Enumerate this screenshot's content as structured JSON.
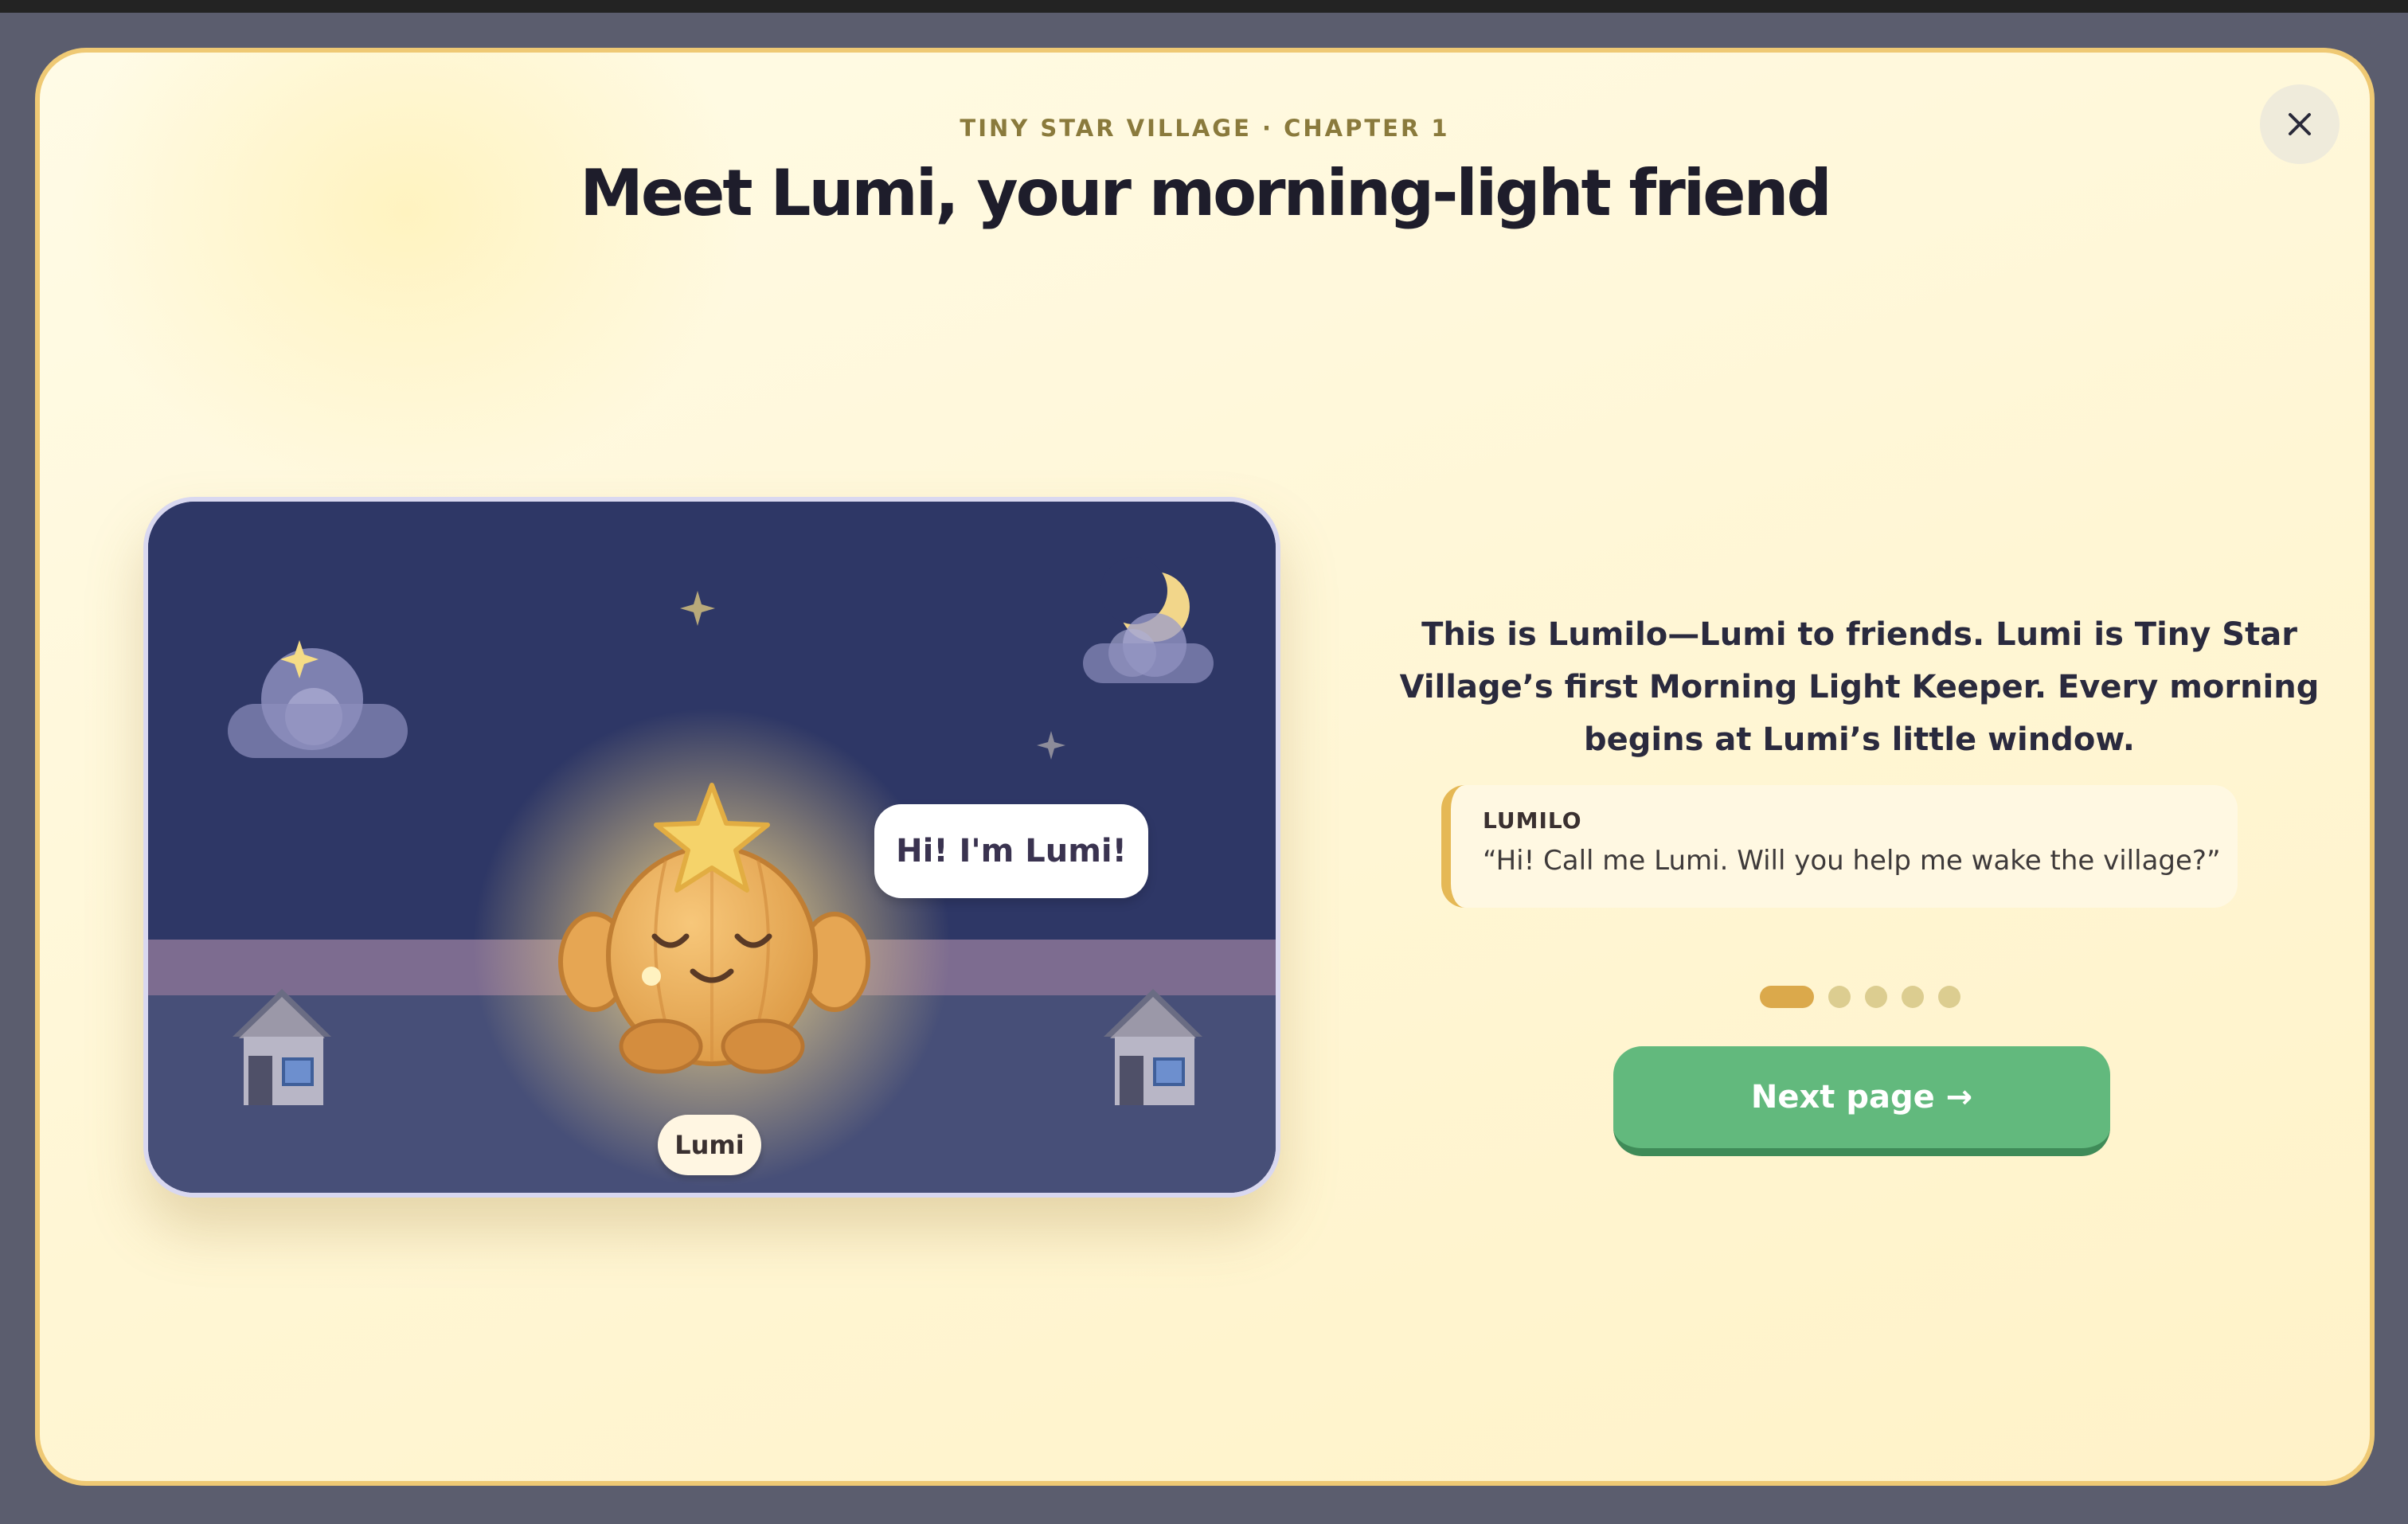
{
  "modal": {
    "eyebrow": "TINY STAR VILLAGE · CHAPTER 1",
    "title": "Meet Lumi, your morning-light friend",
    "close_icon": "close-icon"
  },
  "scene": {
    "speech_bubble": "Hi! I'm Lumi!",
    "name_tag": "Lumi",
    "icons": [
      "moon-icon",
      "star-icon",
      "cloud-icon",
      "house-icon"
    ],
    "colors": {
      "sky": "#2e3766",
      "ground": "#474f78",
      "horizon": "#7d6c90",
      "character": "#e6a653"
    }
  },
  "story": {
    "text": "This is Lumilo—Lumi to friends. Lumi is Tiny Star Village’s first Morning Light Keeper. Every morning begins at Lumi’s little window."
  },
  "quote": {
    "speaker": "LUMILO",
    "text": "“Hi! Call me Lumi. Will you help me wake the village?”"
  },
  "pagination": {
    "total": 5,
    "current": 1,
    "active_color": "#dba94b",
    "inactive_color": "#dccd90"
  },
  "next_button": {
    "label": "Next page →",
    "color": "#62b97d"
  }
}
